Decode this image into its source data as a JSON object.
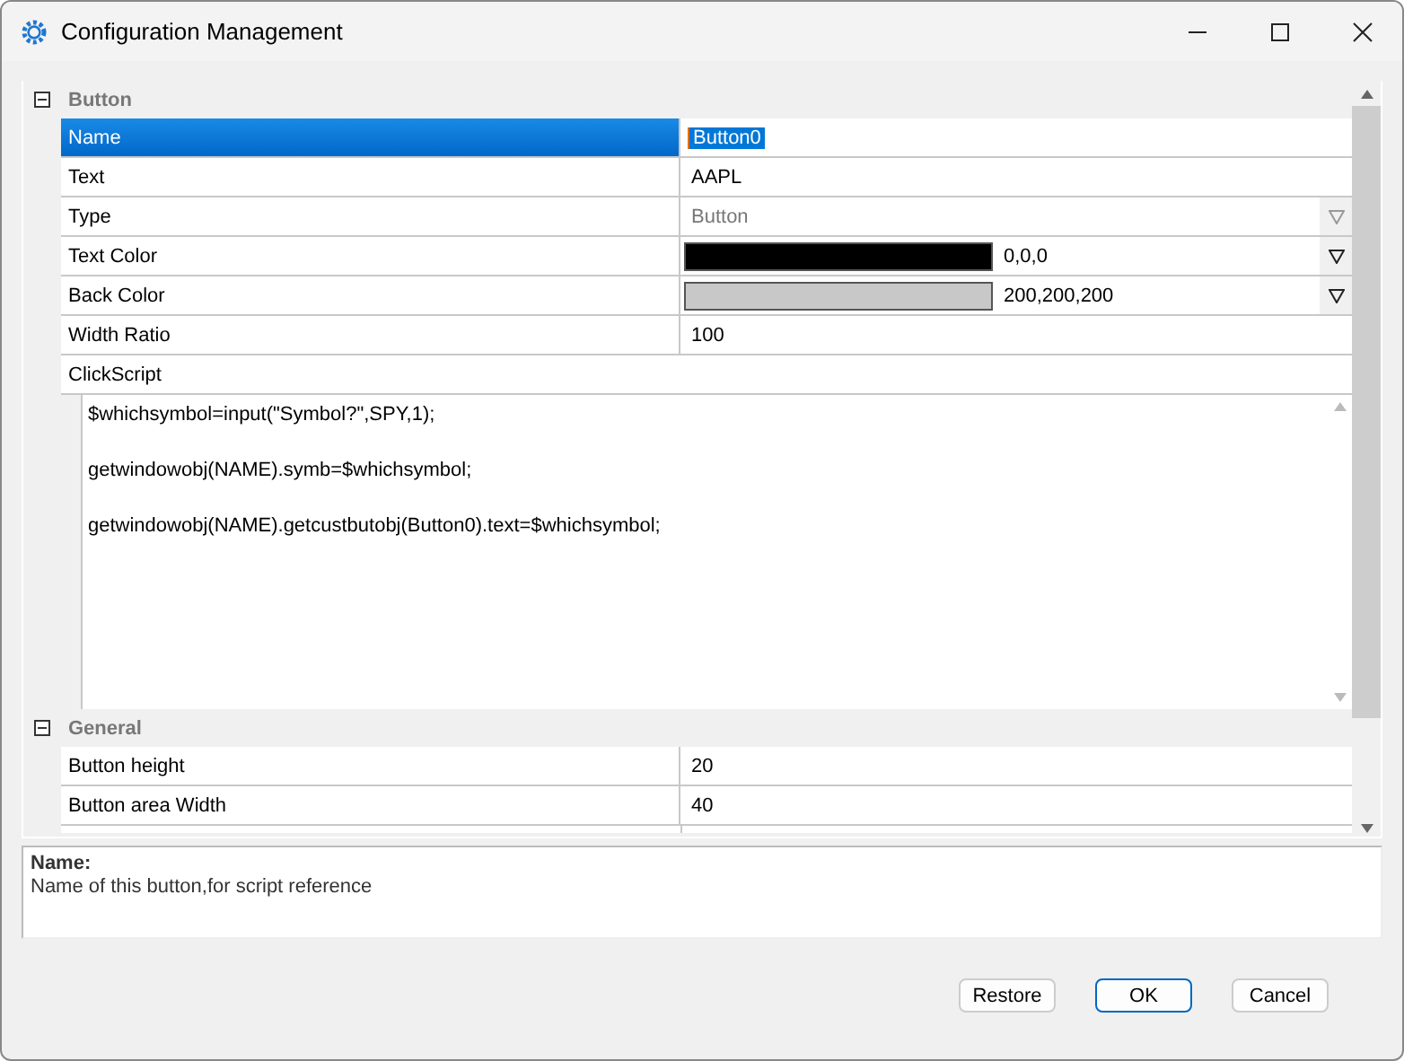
{
  "window": {
    "title": "Configuration Management"
  },
  "groups": [
    {
      "title": "Button",
      "expanded": true,
      "rows": [
        {
          "kind": "text",
          "label": "Name",
          "value": "Button0",
          "selected": true
        },
        {
          "kind": "text",
          "label": "Text",
          "value": "AAPL",
          "selected": false
        },
        {
          "kind": "combo",
          "label": "Type",
          "value": "Button",
          "selected": false,
          "disabled": true
        },
        {
          "kind": "color",
          "label": "Text Color",
          "value": "0,0,0",
          "color": "#000000",
          "selected": false
        },
        {
          "kind": "color",
          "label": "Back Color",
          "value": "200,200,200",
          "color": "#c8c8c8",
          "selected": false
        },
        {
          "kind": "text",
          "label": "Width Ratio",
          "value": "100",
          "selected": false
        },
        {
          "kind": "script",
          "label": "ClickScript",
          "lines": [
            "$whichsymbol=input(\"Symbol?\",SPY,1);",
            "getwindowobj(NAME).symb=$whichsymbol;",
            "getwindowobj(NAME).getcustbutobj(Button0).text=$whichsymbol;"
          ],
          "selected": false
        }
      ]
    },
    {
      "title": "General",
      "expanded": true,
      "rows": [
        {
          "kind": "text",
          "label": "Button height",
          "value": "20",
          "selected": false
        },
        {
          "kind": "text",
          "label": "Button area Width",
          "value": "40",
          "selected": false
        }
      ]
    }
  ],
  "description": {
    "title": "Name:",
    "text": "Name of this button,for script reference"
  },
  "buttons": [
    {
      "label": "Restore",
      "default": false
    },
    {
      "label": "OK",
      "default": true
    },
    {
      "label": "Cancel",
      "default": false
    }
  ]
}
